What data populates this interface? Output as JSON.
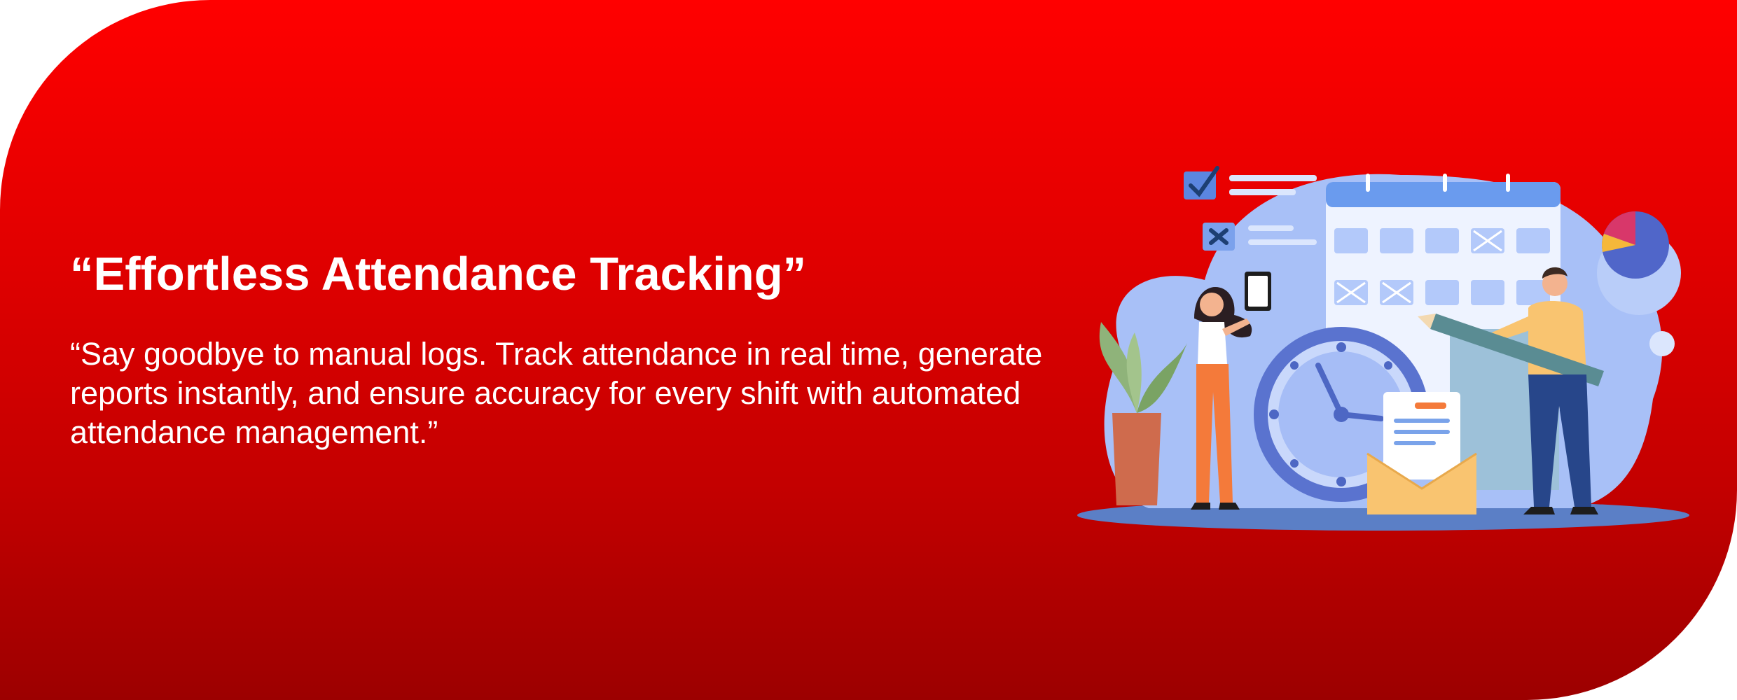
{
  "headline": "“Effortless Attendance Tracking”",
  "description": "“Say goodbye to manual logs. Track attendance in real time, generate reports instantly, and ensure accuracy for every shift with automated attendance management.”",
  "colors": {
    "banner_top": "#ff0000",
    "banner_bottom": "#9c0000",
    "text": "#ffffff",
    "illustration_blue": "#5b72d6",
    "illustration_light_blue": "#a8c0f7",
    "illustration_orange": "#f47a3a",
    "illustration_yellow": "#f9c470"
  },
  "illustration": {
    "icons": [
      "check-checkbox-icon",
      "cross-checkbox-icon",
      "calendar-icon",
      "clock-icon",
      "envelope-icon",
      "pie-chart-icon",
      "potted-plant-icon",
      "clipboard-icon",
      "pencil-icon"
    ],
    "figures": [
      "woman-figure",
      "man-figure"
    ]
  }
}
